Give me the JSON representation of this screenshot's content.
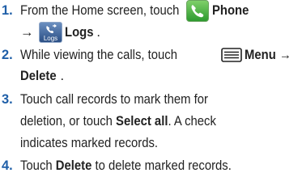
{
  "steps": [
    {
      "number": "1.",
      "line1": {
        "text": "From the Home screen, touch",
        "icon": "phone-icon",
        "bold": "Phone"
      },
      "line2": {
        "arrow": "→",
        "icon": "logs-icon",
        "icon_caption": "Logs",
        "bold": "Logs",
        "end": "."
      }
    },
    {
      "number": "2.",
      "line1": {
        "text": "While viewing the calls, touch",
        "icon": "menu-icon",
        "bold": "Menu →"
      },
      "line2": {
        "bold": "Delete",
        "end": "."
      }
    },
    {
      "number": "3.",
      "lines": [
        {
          "pre": "Touch call records to mark them for",
          "bold": "",
          "post": ""
        },
        {
          "pre": "deletion, or touch ",
          "bold": "Select all",
          "post": ". A check"
        },
        {
          "pre": "indicates marked records.",
          "bold": "",
          "post": ""
        }
      ]
    },
    {
      "number": "4.",
      "line": {
        "pre": "Touch ",
        "bold": "Delete",
        "post": " to delete marked records."
      }
    }
  ],
  "colors": {
    "step_number": "#1f5fa8",
    "text": "#222222",
    "phone_icon": "#3aa33a",
    "logs_icon": "#2f5a93"
  }
}
